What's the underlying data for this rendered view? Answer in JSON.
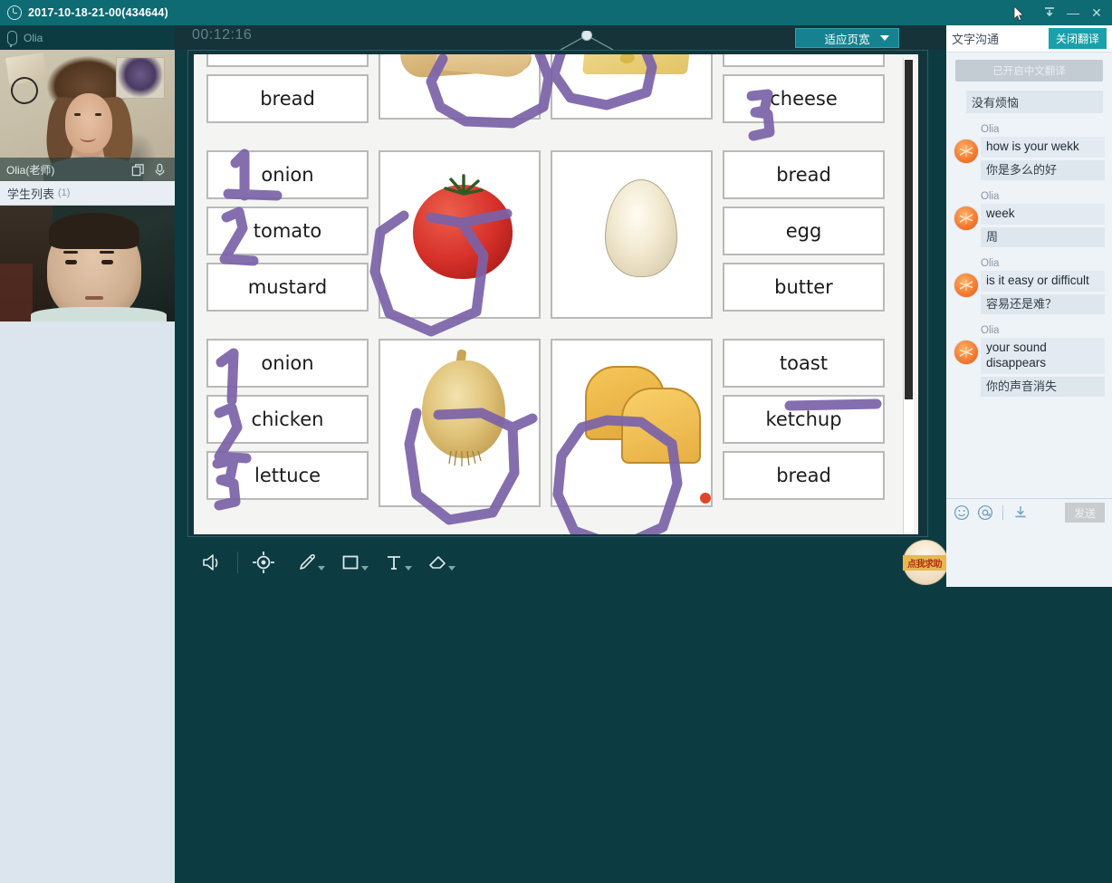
{
  "titlebar": {
    "title": "2017-10-18-21-00(434644)",
    "clock_icon": "clock-icon",
    "download_icon": "download-icon",
    "minimize_label": "—",
    "close_label": "✕"
  },
  "left_panel": {
    "mic_label": "Olia",
    "teacher_name": "Olia(老师)",
    "student_list_label": "学生列表",
    "student_count": "(1)"
  },
  "board_top": {
    "timer": "00:12:16",
    "fit_button": "适应页宽"
  },
  "toolbar": {
    "items": [
      {
        "name": "volume-icon",
        "label": "volume",
        "dropdown": false
      },
      {
        "name": "pointer-target-icon",
        "label": "pointer",
        "dropdown": false
      },
      {
        "name": "pencil-icon",
        "label": "pen",
        "dropdown": true
      },
      {
        "name": "rectangle-icon",
        "label": "shape",
        "dropdown": true
      },
      {
        "name": "text-icon",
        "label": "T",
        "dropdown": true
      },
      {
        "name": "eraser-icon",
        "label": "eraser",
        "dropdown": true
      }
    ]
  },
  "help_badge": {
    "label": "点我求助"
  },
  "chat": {
    "title": "文字沟通",
    "translate_button": "关闭翻译",
    "system_pill": "已开启中文翻译",
    "system_plain": "没有烦恼",
    "messages": [
      {
        "sender": "Olia",
        "en": "how is your wekk",
        "zh": "你是多么的好"
      },
      {
        "sender": "Olia",
        "en": "week",
        "zh": "周"
      },
      {
        "sender": "Olia",
        "en": "is it easy or difficult",
        "zh": "容易还是难？"
      },
      {
        "sender": "Olia",
        "en": "your sound disappears",
        "zh": "你的声音消失"
      }
    ],
    "input_icons": [
      {
        "name": "emoji-icon"
      },
      {
        "name": "mention-icon"
      },
      {
        "name": "download-icon"
      }
    ],
    "send_button": "发送"
  },
  "worksheet": {
    "rows": [
      {
        "left_words": [
          "",
          "bread"
        ],
        "left_picture": "sandwich-image",
        "right_picture": "cheese-image",
        "right_words": [
          "",
          "cheese"
        ],
        "left_numbers": [],
        "right_numbers": [
          "3"
        ]
      },
      {
        "left_words": [
          "onion",
          "tomato",
          "mustard"
        ],
        "left_picture": "tomato-image",
        "right_picture": "egg-image",
        "right_words": [
          "bread",
          "egg",
          "butter"
        ],
        "left_numbers": [
          "1",
          "2"
        ],
        "right_numbers": []
      },
      {
        "left_words": [
          "onion",
          "chicken",
          "lettuce"
        ],
        "left_picture": "onion-image",
        "right_picture": "toast-image",
        "right_words": [
          "toast",
          "ketchup",
          "bread"
        ],
        "left_numbers": [
          "1",
          "2",
          "3"
        ],
        "right_numbers": []
      }
    ]
  },
  "colors": {
    "titlebar": "#0e6a73",
    "panel_dark": "#0d3b42",
    "board_frame": "#16333a",
    "accent_teal": "#17828f",
    "ink_purple": "#7b62a8",
    "chat_bg": "#eef3f8"
  }
}
